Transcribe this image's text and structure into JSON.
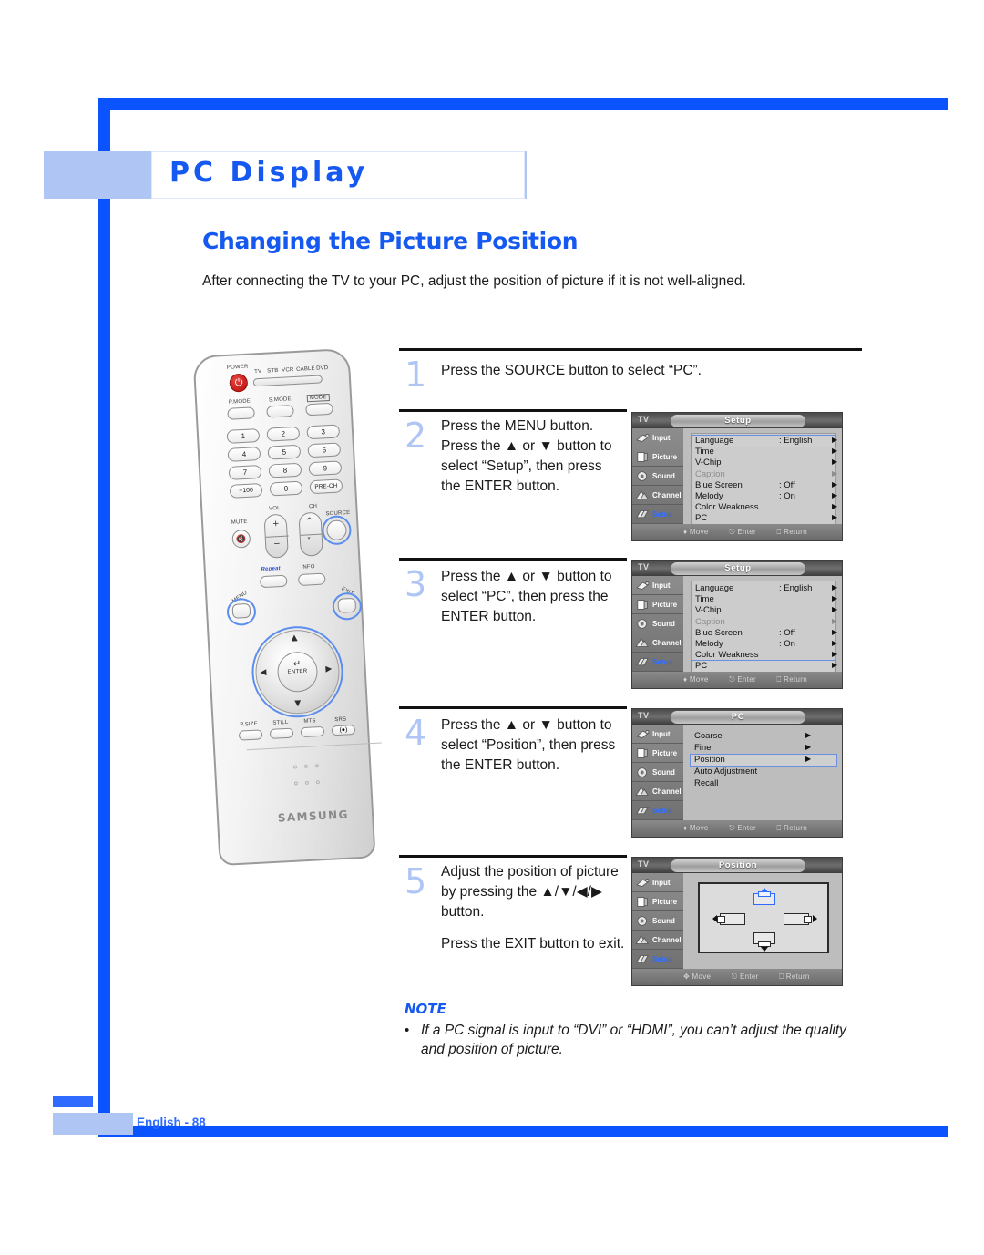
{
  "banner": {
    "title": "PC Display"
  },
  "section": {
    "title": "Changing the Picture Position",
    "intro": "After connecting the TV to your PC, adjust the position of picture if it is not well-aligned."
  },
  "remote": {
    "brand": "SAMSUNG",
    "power_label": "POWER",
    "device_labels": [
      "TV",
      "STB",
      "VCR",
      "CABLE",
      "DVD"
    ],
    "mode_labels": [
      "P.MODE",
      "S.MODE",
      "MODE"
    ],
    "numbers": [
      "1",
      "2",
      "3",
      "4",
      "5",
      "6",
      "7",
      "8",
      "9",
      "+100",
      "0",
      "PRE-CH"
    ],
    "mute_label": "MUTE",
    "vol_label": "VOL",
    "ch_label": "CH",
    "source_label": "SOURCE",
    "repeat_label": "Repeat",
    "info_label": "INFO",
    "menu_label": "MENU",
    "exit_label": "EXIT",
    "enter_label": "ENTER",
    "bottom_labels": [
      "P.SIZE",
      "STILL",
      "MTS",
      "SRS"
    ]
  },
  "steps": [
    {
      "number": "1",
      "lines": [
        "Press the SOURCE button to select “PC”."
      ]
    },
    {
      "number": "2",
      "lines": [
        "Press the MENU button.",
        "Press the ▲ or ▼ button to",
        "select “Setup”, then press",
        "the ENTER button."
      ]
    },
    {
      "number": "3",
      "lines": [
        "Press the ▲ or ▼ button to",
        "select “PC”, then press the",
        "ENTER button."
      ]
    },
    {
      "number": "4",
      "lines": [
        "Press the ▲ or ▼ button to",
        "select “Position”, then press",
        "the ENTER button."
      ]
    },
    {
      "number": "5",
      "lines": [
        "Adjust the position of picture",
        "by pressing the ▲/▼/◀/▶",
        "button."
      ],
      "extra": "Press the EXIT button to exit."
    }
  ],
  "osd_common": {
    "tv_label": "TV",
    "sidebar": [
      {
        "label": "Input",
        "icon": "input-icon",
        "active": false
      },
      {
        "label": "Picture",
        "icon": "picture-icon",
        "active": false
      },
      {
        "label": "Sound",
        "icon": "sound-icon",
        "active": false
      },
      {
        "label": "Channel",
        "icon": "channel-icon",
        "active": false
      },
      {
        "label": "Setup",
        "icon": "setup-icon",
        "active": true
      }
    ],
    "footer": {
      "move": "Move",
      "enter": "Enter",
      "return": "Return"
    }
  },
  "osd_screens": [
    {
      "id": "setup-menu-1",
      "title": "Setup",
      "rows": [
        {
          "name": "Language",
          "value": ": English",
          "arrow": true,
          "selected": true,
          "dim": false
        },
        {
          "name": "Time",
          "value": "",
          "arrow": true,
          "selected": false,
          "dim": false
        },
        {
          "name": "V-Chip",
          "value": "",
          "arrow": true,
          "selected": false,
          "dim": false
        },
        {
          "name": "Caption",
          "value": "",
          "arrow": true,
          "selected": false,
          "dim": true
        },
        {
          "name": "Blue Screen",
          "value": ": Off",
          "arrow": true,
          "selected": false,
          "dim": false
        },
        {
          "name": "Melody",
          "value": ": On",
          "arrow": true,
          "selected": false,
          "dim": false
        },
        {
          "name": "Color Weakness",
          "value": "",
          "arrow": true,
          "selected": false,
          "dim": false
        },
        {
          "name": "PC",
          "value": "",
          "arrow": true,
          "selected": false,
          "dim": false
        }
      ]
    },
    {
      "id": "setup-menu-2",
      "title": "Setup",
      "rows": [
        {
          "name": "Language",
          "value": ": English",
          "arrow": true,
          "selected": false,
          "dim": false
        },
        {
          "name": "Time",
          "value": "",
          "arrow": true,
          "selected": false,
          "dim": false
        },
        {
          "name": "V-Chip",
          "value": "",
          "arrow": true,
          "selected": false,
          "dim": false
        },
        {
          "name": "Caption",
          "value": "",
          "arrow": true,
          "selected": false,
          "dim": true
        },
        {
          "name": "Blue Screen",
          "value": ": Off",
          "arrow": true,
          "selected": false,
          "dim": false
        },
        {
          "name": "Melody",
          "value": ": On",
          "arrow": true,
          "selected": false,
          "dim": false
        },
        {
          "name": "Color Weakness",
          "value": "",
          "arrow": true,
          "selected": false,
          "dim": false
        },
        {
          "name": "PC",
          "value": "",
          "arrow": true,
          "selected": true,
          "dim": false
        }
      ]
    },
    {
      "id": "pc-menu",
      "title": "PC",
      "rows": [
        {
          "name": "Coarse",
          "value": "",
          "arrow": true,
          "selected": false,
          "dim": false
        },
        {
          "name": "Fine",
          "value": "",
          "arrow": true,
          "selected": false,
          "dim": false
        },
        {
          "name": "Position",
          "value": "",
          "arrow": true,
          "selected": true,
          "dim": false
        },
        {
          "name": "Auto Adjustment",
          "value": "",
          "arrow": false,
          "selected": false,
          "dim": false
        },
        {
          "name": "Recall",
          "value": "",
          "arrow": false,
          "selected": false,
          "dim": false
        }
      ]
    },
    {
      "id": "position-menu",
      "title": "Position",
      "graphic": "position-adjust-diagram",
      "rows": []
    }
  ],
  "note": {
    "label": "NOTE",
    "bullet": "•",
    "text": "If a PC signal is input to “DVI” or “HDMI”, you can’t adjust the quality and position of picture."
  },
  "footer": {
    "page_label": "English - 88"
  },
  "colors": {
    "brand_blue": "#1559F0",
    "frame_blue": "#0A53FF",
    "light_blue": "#AFC6F5",
    "accent_blue": "#2f6bff"
  }
}
